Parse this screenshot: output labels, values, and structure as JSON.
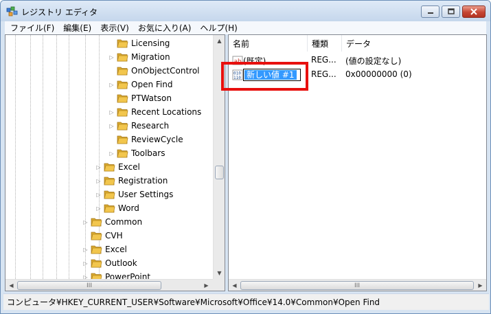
{
  "window": {
    "title": "レジストリ エディタ"
  },
  "menu": [
    "ファイル(F)",
    "編集(E)",
    "表示(V)",
    "お気に入り(A)",
    "ヘルプ(H)"
  ],
  "tree": [
    {
      "label": "Licensing",
      "expandable": false
    },
    {
      "label": "Migration",
      "expandable": true
    },
    {
      "label": "OnObjectControl",
      "expandable": false
    },
    {
      "label": "Open Find",
      "expandable": true
    },
    {
      "label": "PTWatson",
      "expandable": false
    },
    {
      "label": "Recent Locations",
      "expandable": true
    },
    {
      "label": "Research",
      "expandable": true
    },
    {
      "label": "ReviewCycle",
      "expandable": false
    },
    {
      "label": "Toolbars",
      "expandable": true
    },
    {
      "label": "Excel",
      "expandable": true
    },
    {
      "label": "Registration",
      "expandable": true
    },
    {
      "label": "User Settings",
      "expandable": true
    },
    {
      "label": "Word",
      "expandable": true
    },
    {
      "label": "Common",
      "expandable": true
    },
    {
      "label": "CVH",
      "expandable": false
    },
    {
      "label": "Excel",
      "expandable": true
    },
    {
      "label": "Outlook",
      "expandable": true
    },
    {
      "label": "PowerPoint",
      "expandable": true
    }
  ],
  "columns": {
    "name": "名前",
    "type": "種類",
    "data": "データ"
  },
  "values": [
    {
      "name": "(既定)",
      "type": "REG...",
      "data": "(値の設定なし)",
      "icon": "string-value-icon"
    },
    {
      "name": "新しい値 #1",
      "type": "REG...",
      "data": "0x00000000 (0)",
      "icon": "binary-value-icon",
      "editing": true
    }
  ],
  "status": "コンピュータ¥HKEY_CURRENT_USER¥Software¥Microsoft¥Office¥14.0¥Common¥Open Find",
  "scrollbar": {
    "grip": "III"
  },
  "colors": {
    "highlight": "#e8100e",
    "selection": "#3399ff",
    "folder": "#f2c64d"
  }
}
